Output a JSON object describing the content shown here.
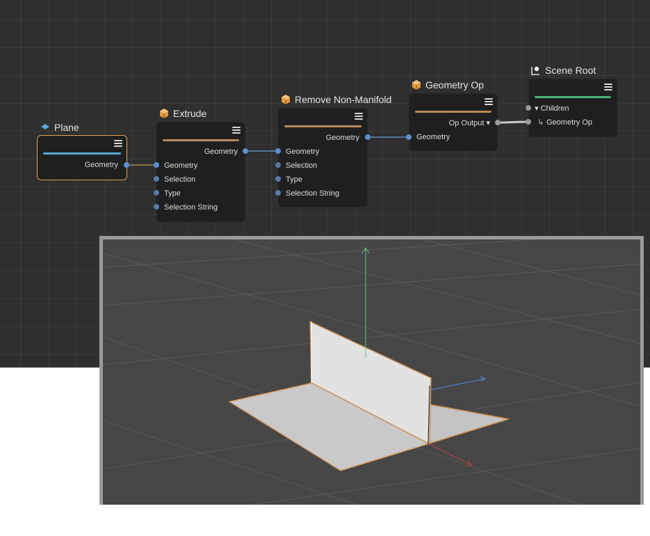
{
  "nodes": {
    "plane": {
      "title": "Plane",
      "icon": "plane-icon",
      "outputs": [
        "Geometry"
      ],
      "bar_color": "#5aa9d8"
    },
    "extrude": {
      "title": "Extrude",
      "icon": "cube-icon",
      "outputs": [
        "Geometry"
      ],
      "inputs": [
        "Geometry",
        "Selection",
        "Type",
        "Selection String"
      ],
      "bar_color": "#b98a5a"
    },
    "remove": {
      "title": "Remove Non-Manifold",
      "icon": "cube-icon",
      "outputs": [
        "Geometry"
      ],
      "inputs": [
        "Geometry",
        "Selection",
        "Type",
        "Selection String"
      ],
      "bar_color": "#b98a5a"
    },
    "geomop": {
      "title": "Geometry Op",
      "icon": "cube-icon",
      "output_label": "Op Output ▾",
      "inputs": [
        "Geometry"
      ],
      "bar_color": "#b98a5a"
    },
    "scene_root": {
      "title": "Scene Root",
      "icon": "scene-root-icon",
      "children_label": "▾ Children",
      "child_item": "Geometry Op",
      "bar_color": "#4fb37a"
    }
  },
  "colors": {
    "port_blue": "#5b8fd0",
    "selection_orange": "#e0a55a",
    "axis_x": "#c0404a",
    "axis_y": "#5fc27a",
    "axis_z": "#4f8fd6"
  }
}
